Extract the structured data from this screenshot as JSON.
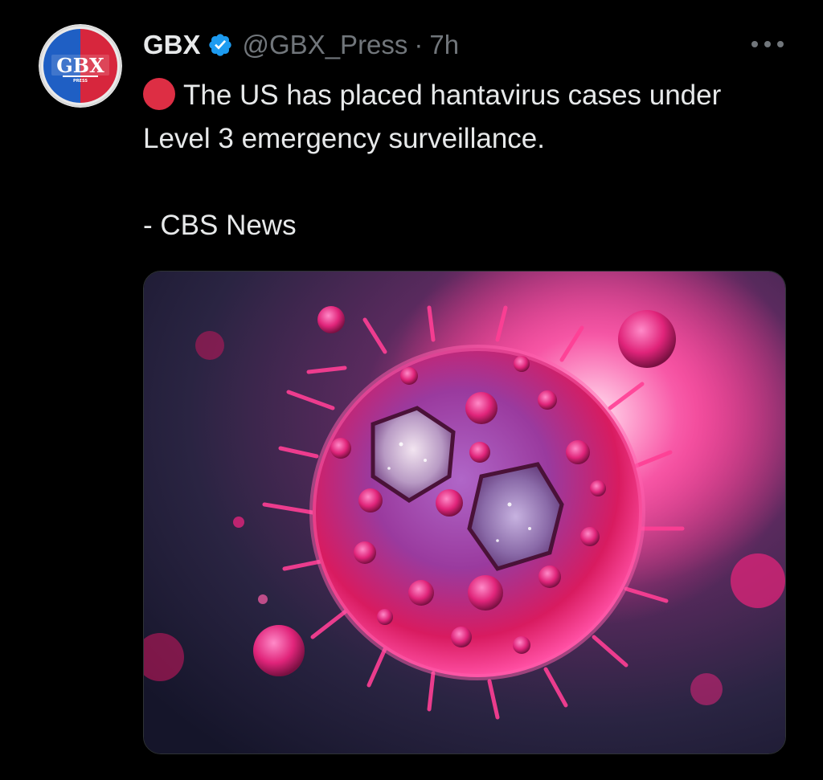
{
  "tweet": {
    "author": {
      "display_name": "GBX",
      "handle": "@GBX_Press",
      "avatar_text": "GBX",
      "avatar_subtext": "PRESS",
      "verified": true
    },
    "separator": "·",
    "time": "7h",
    "text_line": "The US has placed hantavirus cases under Level 3 emergency surveillance.",
    "emoji": "red-circle",
    "source": "- CBS News",
    "media": {
      "kind": "illustration",
      "subject": "virus-particle"
    }
  },
  "colors": {
    "background": "#000000",
    "primary_text": "#e7e9ea",
    "secondary_text": "#71767b",
    "verified_blue": "#1d9bf0",
    "emoji_red": "#dd2e44",
    "virus_magenta": "#d81b60",
    "glow_pink": "#ff4fa3"
  },
  "icons": {
    "verified": "verified-badge-icon",
    "more": "more-dots-icon"
  }
}
